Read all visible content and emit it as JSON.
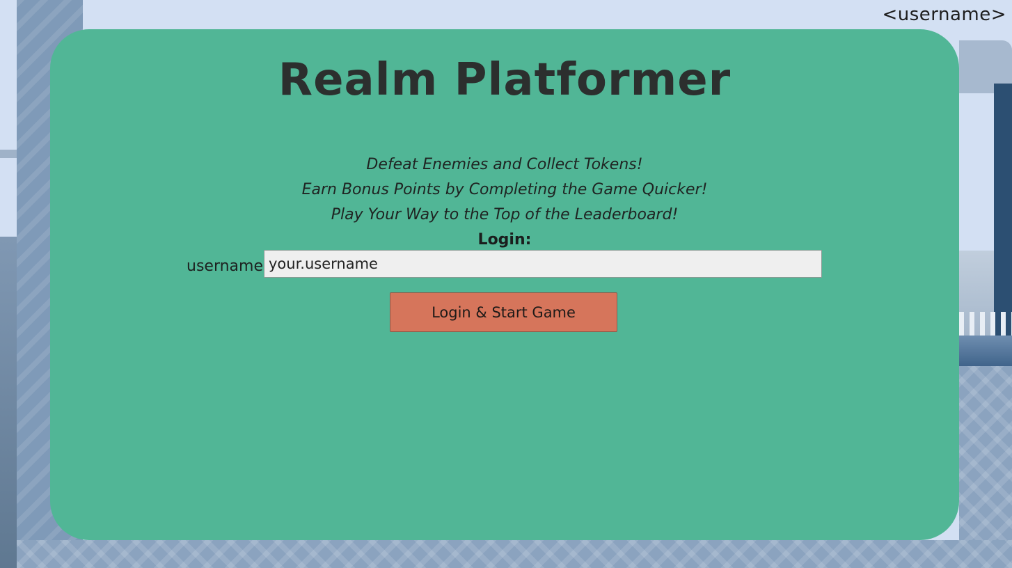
{
  "header": {
    "user_label": "<username>"
  },
  "panel": {
    "title": "Realm Platformer",
    "taglines": [
      "Defeat Enemies and  Collect Tokens!",
      "Earn Bonus Points by Completing the Game Quicker!",
      "Play Your Way to the Top of the Leaderboard!"
    ],
    "login_heading": "Login:",
    "username_label": "username",
    "username_value": "your.username",
    "start_button_label": "Login & Start Game"
  },
  "colors": {
    "panel": "#51b696",
    "button": "#d6755b",
    "sky": "#d3e0f3"
  }
}
